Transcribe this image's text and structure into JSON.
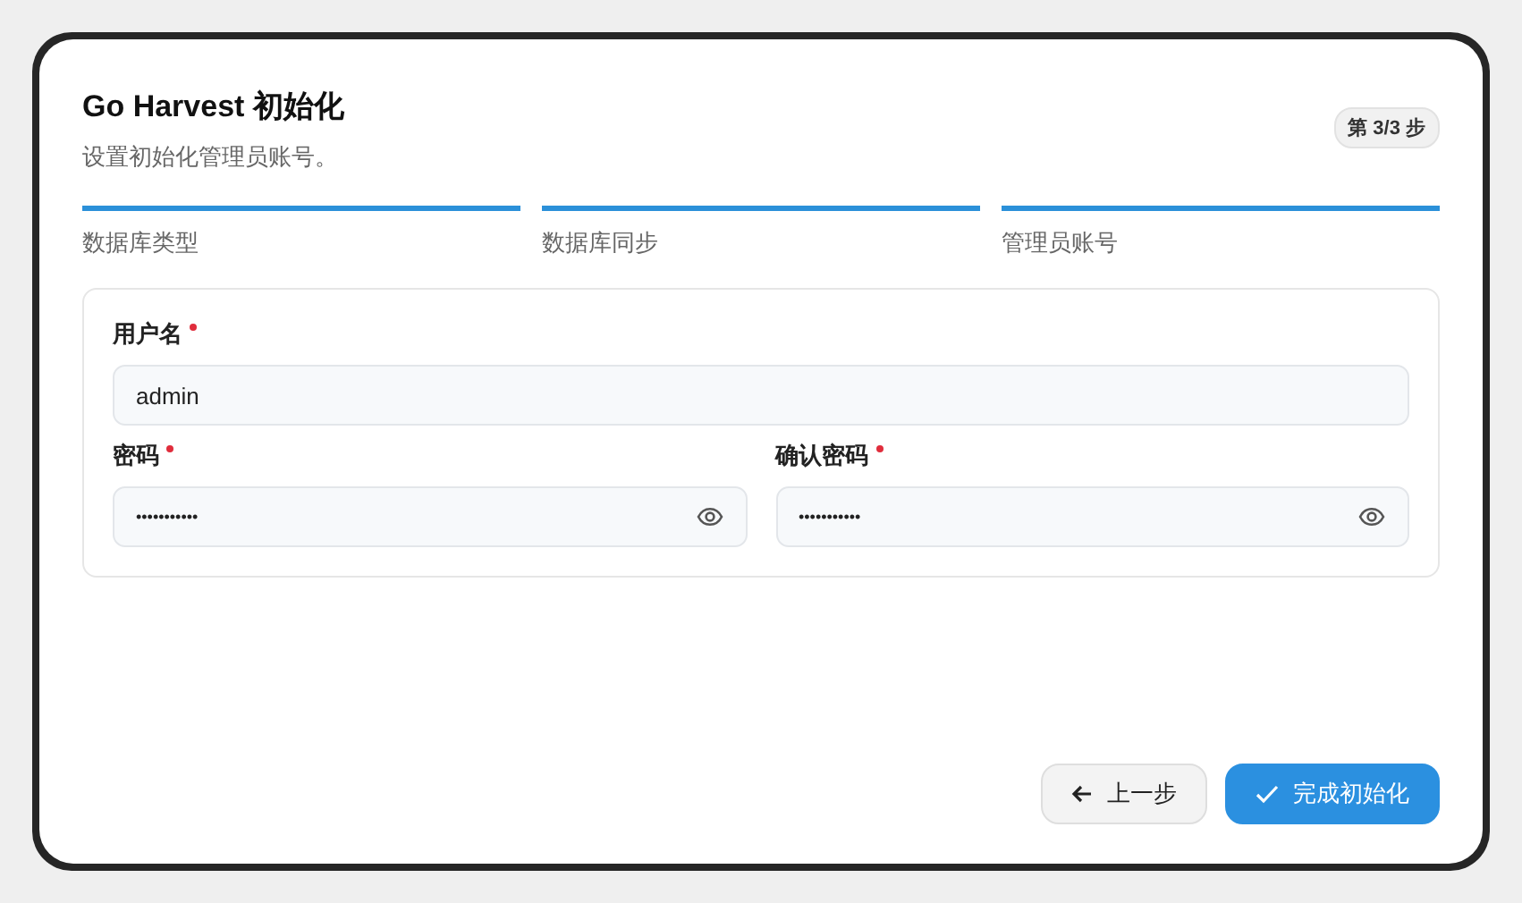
{
  "dialog": {
    "title": "Go Harvest 初始化",
    "subtitle": "设置初始化管理员账号。",
    "step_badge": "第 3/3 步"
  },
  "steps": [
    {
      "label": "数据库类型",
      "done": true
    },
    {
      "label": "数据库同步",
      "done": true
    },
    {
      "label": "管理员账号",
      "done": true
    }
  ],
  "form": {
    "username": {
      "label": "用户名",
      "required": true,
      "value": "admin"
    },
    "password": {
      "label": "密码",
      "required": true,
      "value": "•••••••••••"
    },
    "confirm_password": {
      "label": "确认密码",
      "required": true,
      "value": "•••••••••••"
    }
  },
  "buttons": [
    {
      "kind": "back",
      "label": "上一步"
    },
    {
      "kind": "primary",
      "label": "完成初始化"
    }
  ]
}
